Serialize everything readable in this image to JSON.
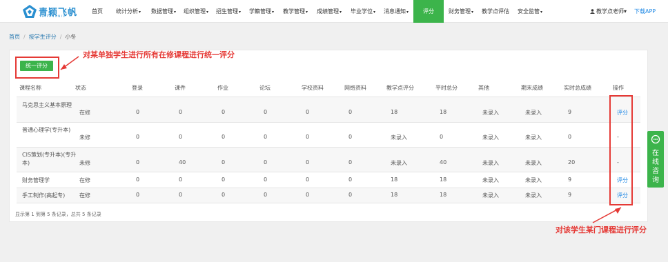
{
  "logo": {
    "text": "青颖飞帆",
    "subtext": "YEIFANUNIV"
  },
  "nav": {
    "items": [
      {
        "label": "首页",
        "dropdown": false,
        "active": false
      },
      {
        "label": "统计分析",
        "dropdown": true,
        "active": false
      },
      {
        "label": "数据管理",
        "dropdown": true,
        "active": false
      },
      {
        "label": "组织管理",
        "dropdown": true,
        "active": false
      },
      {
        "label": "招生管理",
        "dropdown": true,
        "active": false
      },
      {
        "label": "学籍管理",
        "dropdown": true,
        "active": false
      },
      {
        "label": "教学管理",
        "dropdown": true,
        "active": false
      },
      {
        "label": "成绩管理",
        "dropdown": true,
        "active": false
      },
      {
        "label": "毕业学位",
        "dropdown": true,
        "active": false
      },
      {
        "label": "消息通知",
        "dropdown": true,
        "active": false
      },
      {
        "label": "评分",
        "dropdown": false,
        "active": true
      },
      {
        "label": "财务管理",
        "dropdown": true,
        "active": false
      },
      {
        "label": "教学点评估",
        "dropdown": false,
        "active": false
      },
      {
        "label": "安全监管",
        "dropdown": true,
        "active": false
      }
    ],
    "user": "教学点老师",
    "download": "下载APP"
  },
  "breadcrumb": {
    "home": "首页",
    "parent": "按学生评分",
    "current": "小冬"
  },
  "panel": {
    "unified_button": "统一评分",
    "columns": [
      "课程名称",
      "状态",
      "登录",
      "课件",
      "作业",
      "论坛",
      "学校资料",
      "网络资料",
      "教学点评分",
      "平时总分",
      "其他",
      "期末成绩",
      "实时总成绩",
      "操作"
    ],
    "rows": [
      {
        "course": "马克思主义基本原理",
        "status": "在修",
        "login": "0",
        "courseware": "0",
        "homework": "0",
        "forum": "0",
        "school_material": "0",
        "net_material": "0",
        "center_score": "18",
        "usual_total": "18",
        "other": "未录入",
        "final": "未录入",
        "realtime_total": "9",
        "action": "评分"
      },
      {
        "course": "普通心理学(专升本)",
        "status": "未修",
        "login": "0",
        "courseware": "0",
        "homework": "0",
        "forum": "0",
        "school_material": "0",
        "net_material": "0",
        "center_score": "未录入",
        "usual_total": "0",
        "other": "未录入",
        "final": "未录入",
        "realtime_total": "0",
        "action": "-"
      },
      {
        "course": "CIS策划(专升本)(专升本)",
        "status": "未修",
        "login": "0",
        "courseware": "40",
        "homework": "0",
        "forum": "0",
        "school_material": "0",
        "net_material": "0",
        "center_score": "未录入",
        "usual_total": "40",
        "other": "未录入",
        "final": "未录入",
        "realtime_total": "20",
        "action": "-"
      },
      {
        "course": "财务管理学",
        "status": "在修",
        "login": "0",
        "courseware": "0",
        "homework": "0",
        "forum": "0",
        "school_material": "0",
        "net_material": "0",
        "center_score": "18",
        "usual_total": "18",
        "other": "未录入",
        "final": "未录入",
        "realtime_total": "9",
        "action": "评分"
      },
      {
        "course": "手工制作(高起专)",
        "status": "在修",
        "login": "0",
        "courseware": "0",
        "homework": "0",
        "forum": "0",
        "school_material": "0",
        "net_material": "0",
        "center_score": "18",
        "usual_total": "18",
        "other": "未录入",
        "final": "未录入",
        "realtime_total": "9",
        "action": "评分"
      }
    ],
    "summary": "显示第 1 到第 5 条记录，总共 5 条记录"
  },
  "annotations": {
    "top": "对某单独学生进行所有在修课程进行统一评分",
    "bottom": "对该学生某门课程进行评分"
  },
  "consult": {
    "label": "在线咨询"
  },
  "colors": {
    "accent": "#3cb44b",
    "link": "#1e88e5",
    "annotation": "#e53935"
  }
}
